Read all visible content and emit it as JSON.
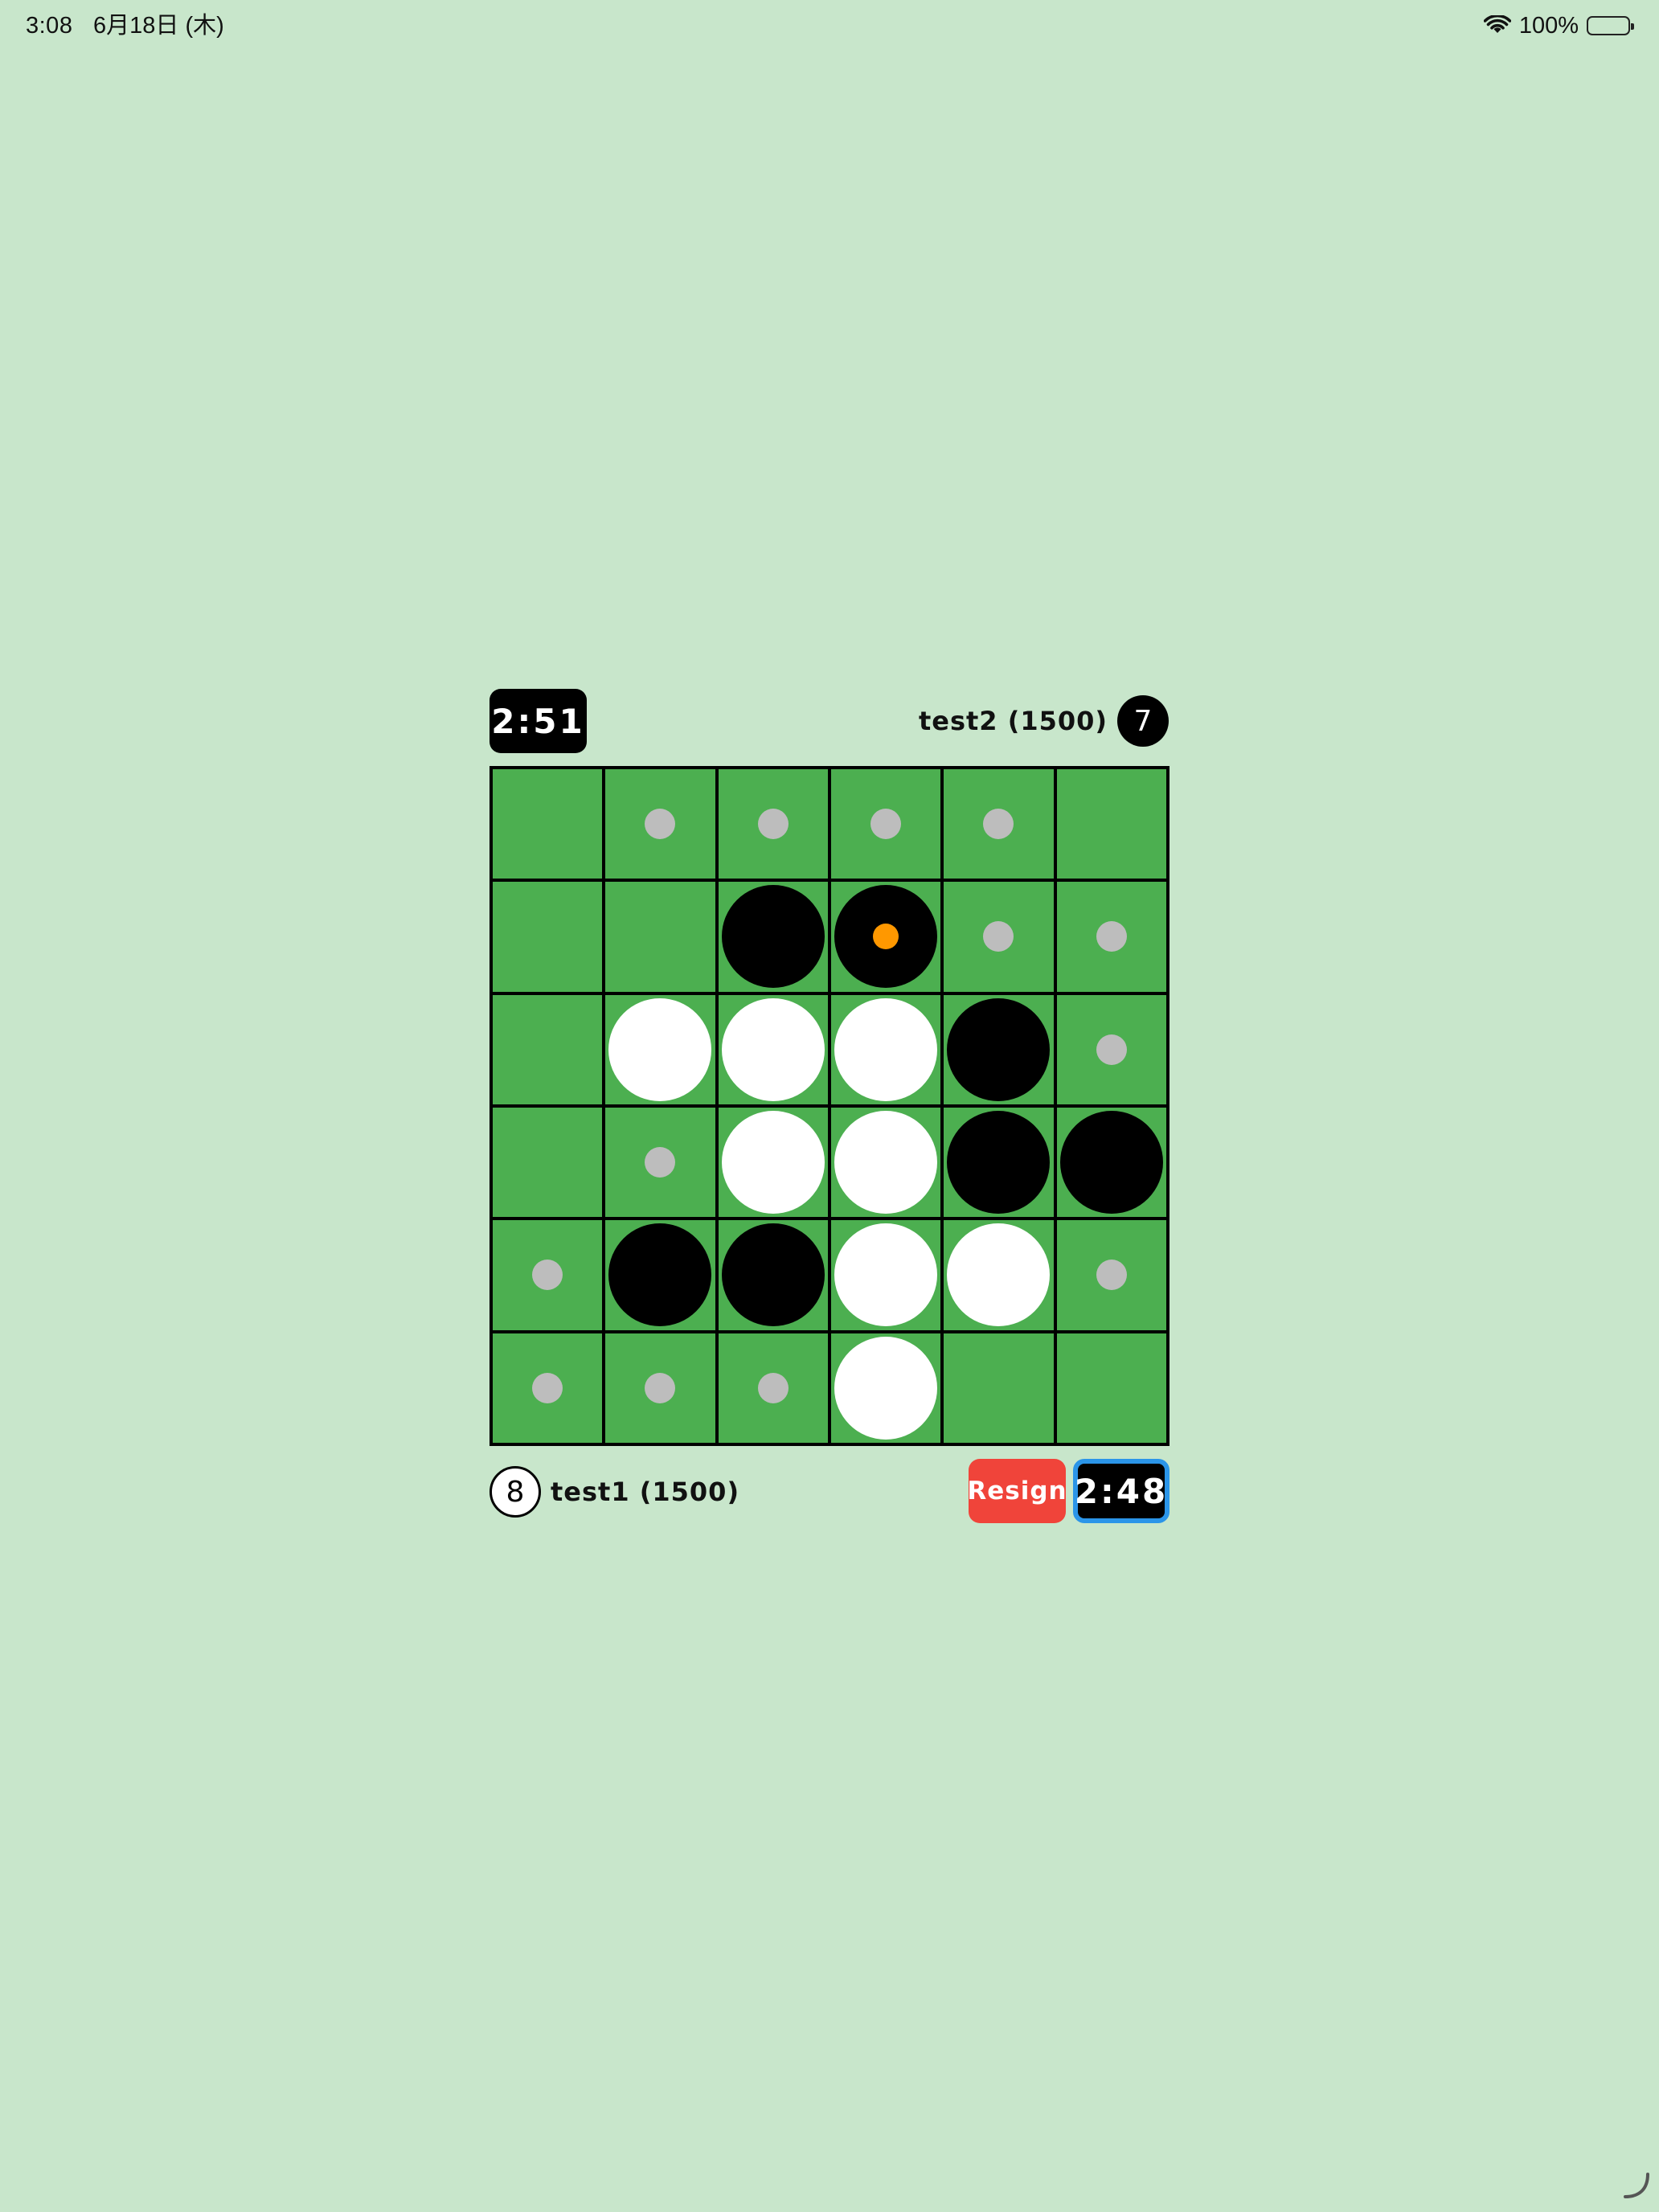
{
  "status_bar": {
    "time": "3:08",
    "date": "6月18日 (木)",
    "battery": "100%",
    "icons": [
      "wifi-icon",
      "battery-icon"
    ]
  },
  "opponent": {
    "timer": "2:51",
    "name": "test2 (1500)",
    "disc_count": "7",
    "color": "black"
  },
  "player": {
    "timer": "2:48",
    "name": "test1 (1500)",
    "disc_count": "8",
    "color": "white",
    "active": true
  },
  "resign_label": "Resign",
  "colors": {
    "background": "#c8e6cb",
    "board_green": "#4caf50",
    "hint_gray": "#bdbdbd",
    "last_move": "#ff9800",
    "resign_red": "#f0443a",
    "active_timer_border": "#2b95e8"
  },
  "board": {
    "size": 6,
    "legend": "B = black disc, W = white disc, . = legal-move hint, - = empty",
    "rows": [
      [
        "-",
        ".",
        ".",
        ".",
        ".",
        "-"
      ],
      [
        "-",
        "-",
        "B",
        "B",
        ".",
        "."
      ],
      [
        "-",
        "W",
        "W",
        "W",
        "B",
        "."
      ],
      [
        "-",
        ".",
        "W",
        "W",
        "B",
        "B"
      ],
      [
        ".",
        "B",
        "B",
        "W",
        "W",
        "."
      ],
      [
        ".",
        ".",
        ".",
        "W",
        "-",
        "-"
      ]
    ],
    "last_move": {
      "row": 2,
      "col": 4
    }
  }
}
